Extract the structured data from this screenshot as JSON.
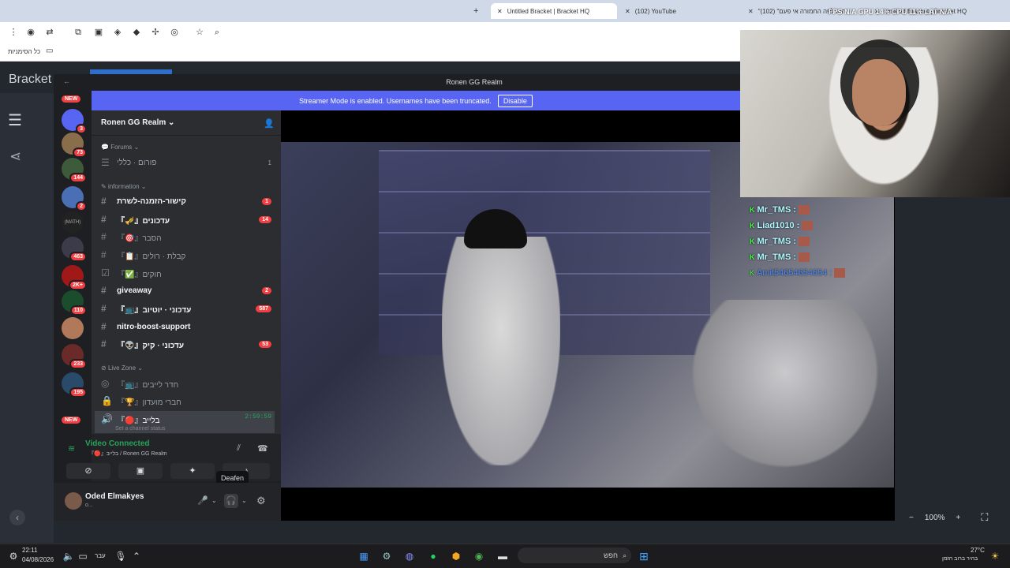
{
  "browser": {
    "tabs": [
      {
        "label": "Untitled Bracket | Bracket HQ"
      },
      {
        "label": "(102) YouTube"
      },
      {
        "label": "\"ההדלפה החמורה אי פעם\" (102)"
      },
      {
        "label": "Untitled Bracket | Bracket HQ"
      }
    ],
    "overlay_stats": "FPS N/A   GPU 14%   CPU 11%   LAT N/A",
    "bookmarks_label": "כל הסימניות"
  },
  "webpage": {
    "brand": "Bracket"
  },
  "discord": {
    "window_title": "Ronen GG Realm",
    "streamer_banner": "Streamer Mode is enabled. Usernames have been truncated.",
    "disable_label": "Disable",
    "server_name": "Ronen GG Realm",
    "guild_badges": [
      "NEW",
      "3",
      "73",
      "144",
      "2",
      "463",
      "2K+",
      "110",
      "233",
      "195",
      "NEW"
    ],
    "categories": {
      "forums": "Forums",
      "information": "information",
      "live": "Live Zone"
    },
    "channels": [
      {
        "name": "פורום · כללי",
        "badge": "1"
      },
      {
        "name": "קישור-הזמנה-לשרת",
        "badge": "1"
      },
      {
        "name": "『🎺』עדכונים",
        "badge": "14"
      },
      {
        "name": "『🎯』הסבר",
        "badge": ""
      },
      {
        "name": "『📋』קבלת · רולים",
        "badge": ""
      },
      {
        "name": "『✅』חוקים",
        "badge": ""
      },
      {
        "name": "giveaway",
        "badge": "2"
      },
      {
        "name": "『📺』עדכוני · יוטיוב",
        "badge": "587"
      },
      {
        "name": "nitro-boost-support",
        "badge": ""
      },
      {
        "name": "『👽』עדכוני · קיק",
        "badge": "53"
      },
      {
        "name": "『📺』חדר לייבים",
        "badge": ""
      },
      {
        "name": "『🏆』חברי מועדון",
        "badge": ""
      },
      {
        "name": "『🔴』בלייב",
        "badge": ""
      }
    ],
    "live_timer": "2:59:59",
    "set_status": "Set a channel status",
    "voice": {
      "status": "Video Connected",
      "location": "『🔴』בלייב / Ronen GG Realm"
    },
    "tooltip": "Deafen",
    "user": {
      "name": "Oded Elmakyes",
      "sub": "o..."
    },
    "chat": [
      {
        "user": "Mr_TMS :"
      },
      {
        "user": "Liad1010 :"
      },
      {
        "user": "Mr_TMS :"
      },
      {
        "user": "Mr_TMS :"
      },
      {
        "user": "Amit54654654654 :"
      }
    ],
    "zoom": "100%"
  },
  "taskbar": {
    "time": "22:11",
    "date": "04/08/2026",
    "lang": "עבר",
    "search": "חפש",
    "temp": "27°C",
    "weather": "בהיר ברוב הזמן"
  },
  "colors": {
    "blurple": "#5865f2",
    "red": "#f23f42",
    "green": "#23a559"
  }
}
